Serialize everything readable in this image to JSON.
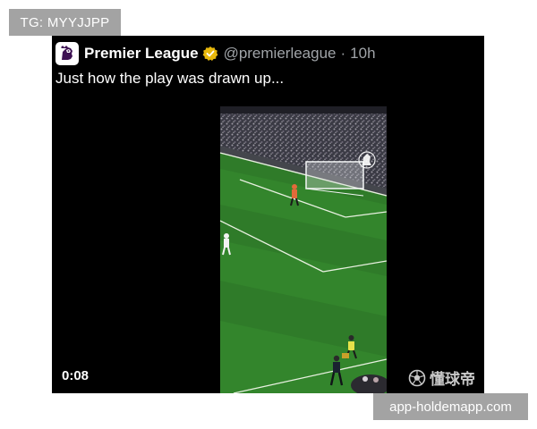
{
  "top_badge": {
    "text": "TG: MYYJJPP"
  },
  "post": {
    "author_name": "Premier League",
    "handle": "@premierleague",
    "separator": "·",
    "time": "10h",
    "text": "Just how the play was drawn up...",
    "icons": {
      "avatar": "premier-league-lion-logo",
      "verified": "gold-verified-badge"
    },
    "colors": {
      "background": "#000000",
      "verified": "#e8b80c",
      "secondary_text": "#a0a4a8"
    }
  },
  "video": {
    "duration": "0:08",
    "watermark_text": "懂球帝",
    "watermark_icon": "football-icon"
  },
  "bottom_badge": {
    "text": "app-holdemapp.com"
  }
}
